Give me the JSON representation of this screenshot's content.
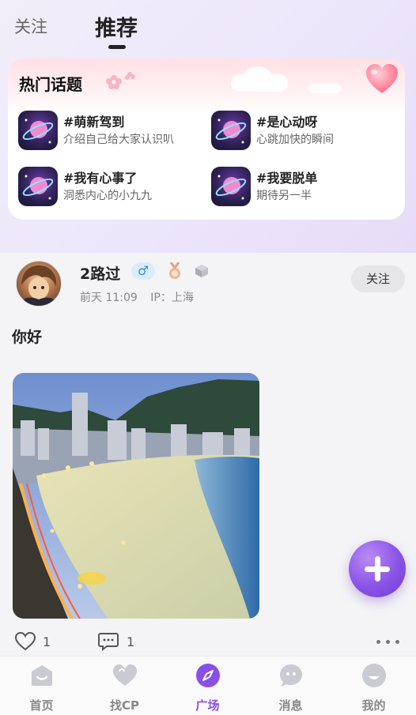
{
  "tabs": {
    "follow": "关注",
    "recommend": "推荐"
  },
  "hot_topics": {
    "title": "热门话题",
    "items": [
      {
        "name": "#萌新驾到",
        "desc": "介绍自己给大家认识叭"
      },
      {
        "name": "#是心动呀",
        "desc": "心跳加快的瞬间"
      },
      {
        "name": "#我有心事了",
        "desc": "洞悉内心的小九九"
      },
      {
        "name": "#我要脱单",
        "desc": "期待另一半"
      }
    ]
  },
  "post": {
    "username": "2路过",
    "gender_symbol": "♂",
    "time": "前天 11:09",
    "ip": "IP：上海",
    "follow_label": "关注",
    "text": "你好",
    "likes": "1",
    "comments": "1"
  },
  "bottom_nav": {
    "items": [
      {
        "label": "首页",
        "icon": "home-icon"
      },
      {
        "label": "找CP",
        "icon": "heart-icon"
      },
      {
        "label": "广场",
        "icon": "compass-icon"
      },
      {
        "label": "消息",
        "icon": "chat-icon"
      },
      {
        "label": "我的",
        "icon": "profile-icon"
      }
    ],
    "active": "广场"
  },
  "colors": {
    "accent": "#8a4fe6",
    "gender_badge": "#2f8cf0"
  }
}
